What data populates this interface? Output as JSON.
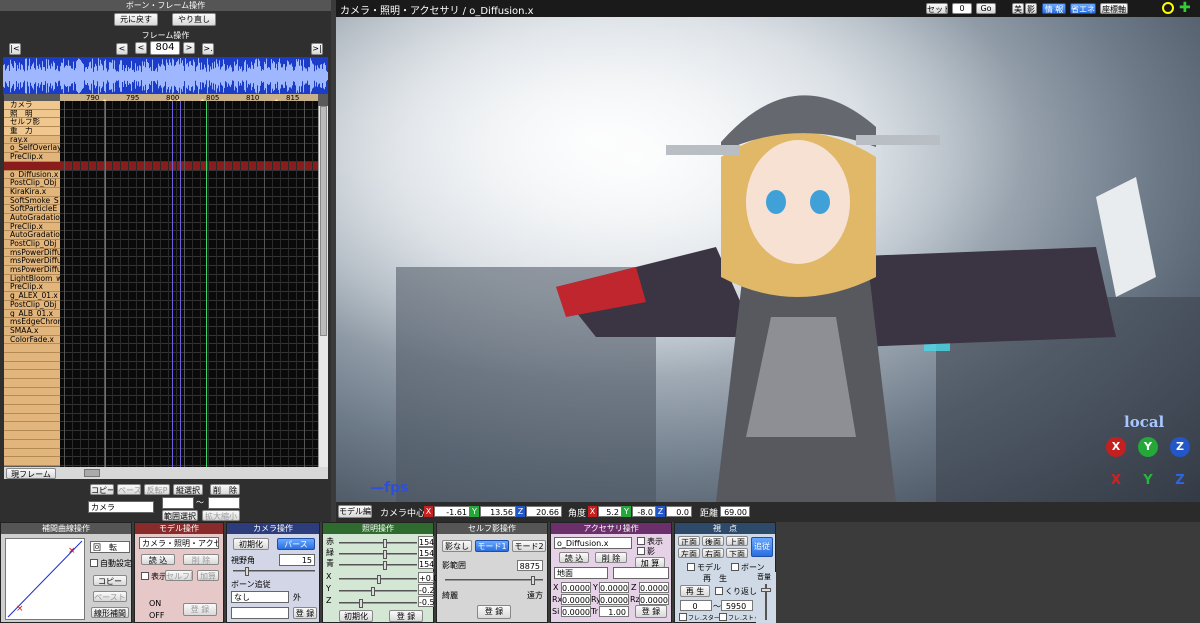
{
  "bone_frame": {
    "title": "ボーン・フレーム操作",
    "undo_label": "元に戻す",
    "redo_label": "やり直し"
  },
  "frame_ops": {
    "title": "フレーム操作",
    "frame_value": "804",
    "first_label": "|<",
    "prev_key_label": "<",
    "prev_label": "<",
    "next_label": ">",
    "next_key_label": ">.",
    "last_label": ">|",
    "ruler_labels": [
      "790",
      "795",
      "800",
      "805",
      "810",
      "815"
    ]
  },
  "tracks": [
    {
      "label": "カメラ",
      "header": true
    },
    {
      "label": "照　明",
      "header": true
    },
    {
      "label": "セルフ影",
      "header": true
    },
    {
      "label": "重　力",
      "header": true
    },
    {
      "label": "ray.x"
    },
    {
      "label": "o_SelfOverlay"
    },
    {
      "label": "PreClip.x"
    },
    {
      "label": "",
      "red": true
    },
    {
      "label": "o_Diffusion.x"
    },
    {
      "label": "PostClip_Obj"
    },
    {
      "label": "KiraKira.x"
    },
    {
      "label": "SoftSmoke_S"
    },
    {
      "label": "SoftParticleE"
    },
    {
      "label": "AutoGradatio"
    },
    {
      "label": "PreClip.x"
    },
    {
      "label": "AutoGradatio"
    },
    {
      "label": "PostClip_Obj"
    },
    {
      "label": "msPowerDiffu"
    },
    {
      "label": "msPowerDiffu"
    },
    {
      "label": "msPowerDiffu"
    },
    {
      "label": "LightBloom_w"
    },
    {
      "label": "PreClip.x"
    },
    {
      "label": "g_ALEX_01.x"
    },
    {
      "label": "PostClip_Obj"
    },
    {
      "label": "g_ALB_01.x"
    },
    {
      "label": "msEdgeChrom"
    },
    {
      "label": "SMAA.x"
    },
    {
      "label": "ColorFade.x"
    }
  ],
  "timeline_bottom": {
    "current_frame_label": "現フレーム",
    "copy_label": "コピー",
    "paste_label": "ペースト",
    "reverse_paste_label": "反転P",
    "vertical_select_label": "縦選択",
    "delete_label": "削　除",
    "target_select": "カメラ",
    "range_select_label": "範囲選択",
    "expand_shrink_label": "拡大縮小",
    "range_tilde": "～"
  },
  "viewport": {
    "title": "カメラ・照明・アクセサリ / o_Diffusion.x",
    "set_label": "セット",
    "set_value": "0",
    "go_label": "Go",
    "btn_shadow": "影",
    "btn_bi": "美",
    "btn_info": "情 報",
    "btn_eco": "省エネ",
    "btn_axis": "座標軸",
    "local_label": "local",
    "fps_label": "—fps",
    "gizmo_x": "X",
    "gizmo_y": "Y",
    "gizmo_z": "Z"
  },
  "camera_status": {
    "model_edit_label": "モデル編",
    "center_label": "カメラ中心",
    "cx": "-1.61",
    "cy": "13.56",
    "cz": "20.66",
    "angle_label": "角度",
    "ax": "5.2",
    "ay": "-8.0",
    "az": "0.0",
    "distance_label": "距離",
    "distance": "69.00"
  },
  "interp": {
    "title": "補間曲線操作",
    "rotate_select": "回　転",
    "auto_label": "自動設定",
    "copy_label": "コピー",
    "paste_label": "ペースト",
    "linear_label": "線形補間"
  },
  "model_ops": {
    "title": "モデル操作",
    "model_select": "カメラ・照明・アクセサリ",
    "load_label": "読 込",
    "delete_label": "削 除",
    "display_label": "表示",
    "self_shadow_label": "セルフ影",
    "add_label": "加算",
    "on_label": "ON",
    "off_label": "OFF",
    "register_label": "登 録"
  },
  "camera_ops": {
    "title": "カメラ操作",
    "reset_label": "初期化",
    "perspective_label": "パース",
    "fov_label": "視野角",
    "fov_value": "15",
    "follow_label": "ボーン追従",
    "follow_select": "なし",
    "outside_label": "外",
    "register_label": "登 録"
  },
  "light_ops": {
    "title": "照明操作",
    "r_label": "赤",
    "g_label": "緑",
    "b_label": "青",
    "r_value": "154",
    "g_value": "154",
    "b_value": "154",
    "x_label": "X",
    "y_label": "Y",
    "z_label": "Z",
    "x_value": "+0.0",
    "y_value": "-0.2",
    "z_value": "-0.5",
    "reset_label": "初期化",
    "register_label": "登 録"
  },
  "self_shadow": {
    "title": "セルフ影操作",
    "none_label": "影なし",
    "mode1_label": "モード1",
    "mode2_label": "モード2",
    "range_label": "影範囲",
    "range_value": "8875",
    "near_label": "綺麗",
    "far_label": "遠方",
    "register_label": "登 録"
  },
  "accessory": {
    "title": "アクセサリ操作",
    "select": "o_Diffusion.x",
    "display_label": "表示",
    "shadow_label": "影",
    "load_label": "読 込",
    "delete_label": "削 除",
    "add_label": "加 算",
    "parent_select": "地面",
    "x_label": "X",
    "y_label": "Y",
    "z_label": "Z",
    "rx_label": "Rx",
    "ry_label": "Ry",
    "rz_label": "Rz",
    "si_label": "Si",
    "tr_label": "Tr",
    "x": "0.0000",
    "y": "0.0000",
    "z": "0.0000",
    "rx": "0.0000",
    "ry": "0.0000",
    "rz": "0.0000",
    "si": "0.0000",
    "tr": "1.00",
    "register_label": "登 録"
  },
  "view": {
    "title": "視　点",
    "front": "正面",
    "back": "後面",
    "top": "上面",
    "left": "左面",
    "right": "右面",
    "bottom": "下面",
    "follow": "追従",
    "model_label": "モデル",
    "bone_label": "ボーン"
  },
  "playback": {
    "title": "再　生",
    "play_label": "再 生",
    "repeat_label": "くり返し",
    "from": "0",
    "to": "5950",
    "tilde": "～",
    "frame_start_label": "フレ.スタート",
    "frame_stop_label": "フレ.ストップ",
    "volume_label": "音量"
  }
}
